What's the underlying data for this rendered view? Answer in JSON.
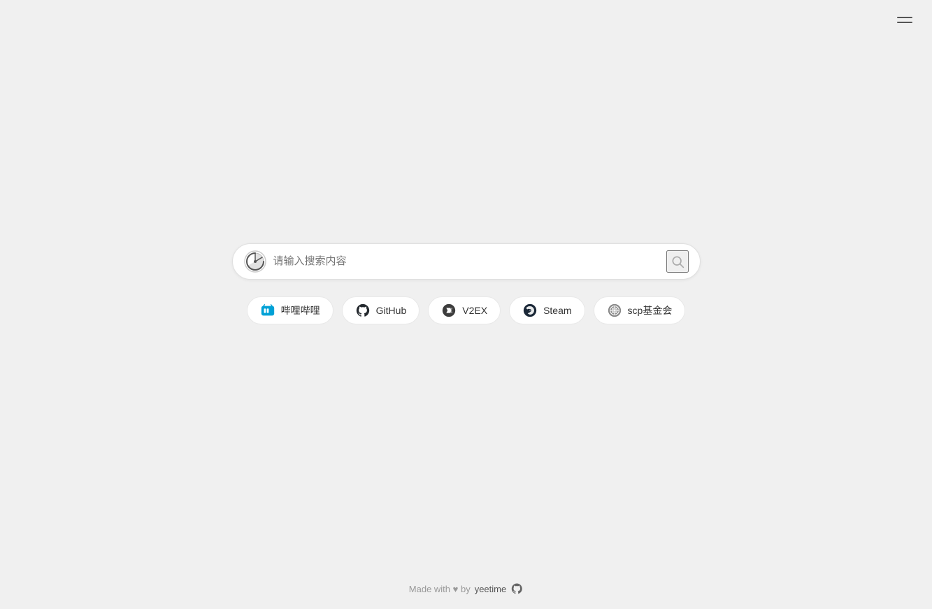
{
  "header": {
    "menu_label": "menu"
  },
  "search": {
    "placeholder": "请输入搜索内容",
    "value": ""
  },
  "shortcuts": [
    {
      "id": "bilibili",
      "label": "哔哩哔哩",
      "icon": "bilibili-icon",
      "color": "#00a1d6"
    },
    {
      "id": "github",
      "label": "GitHub",
      "icon": "github-icon",
      "color": "#24292e"
    },
    {
      "id": "v2ex",
      "label": "V2EX",
      "icon": "v2ex-icon",
      "color": "#3d3d3d"
    },
    {
      "id": "steam",
      "label": "Steam",
      "icon": "steam-icon",
      "color": "#1b2838"
    },
    {
      "id": "scp",
      "label": "scp基金会",
      "icon": "scp-icon",
      "color": "#666"
    }
  ],
  "footer": {
    "text": "Made with by",
    "brand": "yeetime"
  }
}
